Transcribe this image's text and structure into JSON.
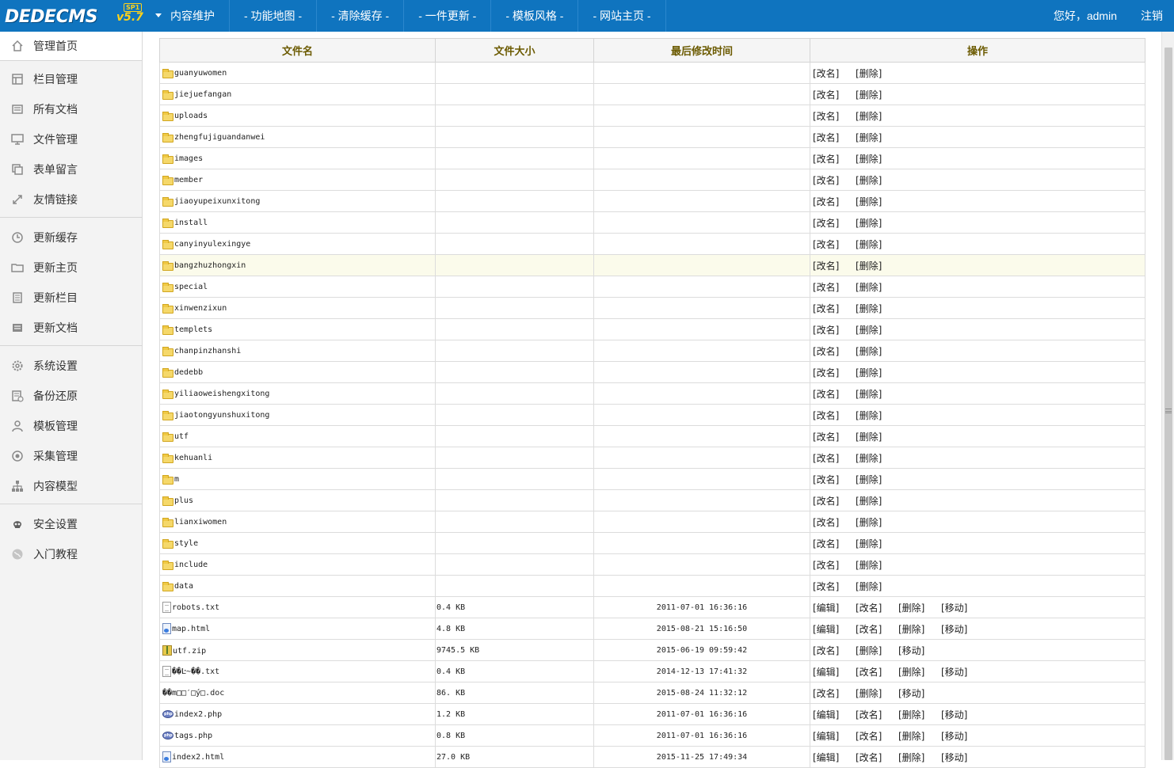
{
  "header": {
    "logo_text": "DEDECMS",
    "logo_version": "v5.7",
    "logo_badge": "SP1",
    "nav": [
      "内容维护",
      "- 功能地图 -",
      "- 清除缓存 -",
      "- 一件更新 -",
      "- 模板风格 -",
      "- 网站主页 -"
    ],
    "user_greeting": "您好，admin",
    "logout": "注销"
  },
  "sidebar": {
    "items": [
      {
        "label": "管理首页",
        "icon": "home-icon"
      },
      {
        "label": "栏目管理",
        "icon": "column-icon"
      },
      {
        "label": "所有文档",
        "icon": "document-icon"
      },
      {
        "label": "文件管理",
        "icon": "monitor-icon"
      },
      {
        "label": "表单留言",
        "icon": "copy-icon"
      },
      {
        "label": "友情链接",
        "icon": "link-icon"
      },
      {
        "label": "更新缓存",
        "icon": "clock-icon"
      },
      {
        "label": "更新主页",
        "icon": "folder-icon"
      },
      {
        "label": "更新栏目",
        "icon": "calendar-icon"
      },
      {
        "label": "更新文档",
        "icon": "list-icon"
      },
      {
        "label": "系统设置",
        "icon": "gear-icon"
      },
      {
        "label": "备份还原",
        "icon": "backup-icon"
      },
      {
        "label": "模板管理",
        "icon": "user-icon"
      },
      {
        "label": "采集管理",
        "icon": "collect-icon"
      },
      {
        "label": "内容模型",
        "icon": "sitemap-icon"
      },
      {
        "label": "安全设置",
        "icon": "skull-icon"
      },
      {
        "label": "入门教程",
        "icon": "globe-icon"
      }
    ]
  },
  "table": {
    "headers": [
      "文件名",
      "文件大小",
      "最后修改时间",
      "操作"
    ],
    "ops": {
      "edit": "[编辑]",
      "rename": "[改名]",
      "delete": "[删除]",
      "move": "[移动]"
    },
    "rows": [
      {
        "name": "guanyuwomen",
        "type": "folder",
        "size": "",
        "time": "",
        "ops": [
          "rename",
          "delete"
        ]
      },
      {
        "name": "jiejuefangan",
        "type": "folder",
        "size": "",
        "time": "",
        "ops": [
          "rename",
          "delete"
        ]
      },
      {
        "name": "uploads",
        "type": "folder",
        "size": "",
        "time": "",
        "ops": [
          "rename",
          "delete"
        ]
      },
      {
        "name": "zhengfujiguandanwei",
        "type": "folder",
        "size": "",
        "time": "",
        "ops": [
          "rename",
          "delete"
        ]
      },
      {
        "name": "images",
        "type": "folder",
        "size": "",
        "time": "",
        "ops": [
          "rename",
          "delete"
        ]
      },
      {
        "name": "member",
        "type": "folder",
        "size": "",
        "time": "",
        "ops": [
          "rename",
          "delete"
        ]
      },
      {
        "name": "jiaoyupeixunxitong",
        "type": "folder",
        "size": "",
        "time": "",
        "ops": [
          "rename",
          "delete"
        ]
      },
      {
        "name": "install",
        "type": "folder",
        "size": "",
        "time": "",
        "ops": [
          "rename",
          "delete"
        ]
      },
      {
        "name": "canyinyulexingye",
        "type": "folder",
        "size": "",
        "time": "",
        "ops": [
          "rename",
          "delete"
        ]
      },
      {
        "name": "bangzhuzhongxin",
        "type": "folder",
        "size": "",
        "time": "",
        "ops": [
          "rename",
          "delete"
        ],
        "highlight": true
      },
      {
        "name": "special",
        "type": "folder",
        "size": "",
        "time": "",
        "ops": [
          "rename",
          "delete"
        ]
      },
      {
        "name": "xinwenzixun",
        "type": "folder",
        "size": "",
        "time": "",
        "ops": [
          "rename",
          "delete"
        ]
      },
      {
        "name": "templets",
        "type": "folder",
        "size": "",
        "time": "",
        "ops": [
          "rename",
          "delete"
        ]
      },
      {
        "name": "chanpinzhanshi",
        "type": "folder",
        "size": "",
        "time": "",
        "ops": [
          "rename",
          "delete"
        ]
      },
      {
        "name": "dedebb",
        "type": "folder",
        "size": "",
        "time": "",
        "ops": [
          "rename",
          "delete"
        ]
      },
      {
        "name": "yiliaoweishengxitong",
        "type": "folder",
        "size": "",
        "time": "",
        "ops": [
          "rename",
          "delete"
        ]
      },
      {
        "name": "jiaotongyunshuxitong",
        "type": "folder",
        "size": "",
        "time": "",
        "ops": [
          "rename",
          "delete"
        ]
      },
      {
        "name": "utf",
        "type": "folder",
        "size": "",
        "time": "",
        "ops": [
          "rename",
          "delete"
        ]
      },
      {
        "name": "kehuanli",
        "type": "folder",
        "size": "",
        "time": "",
        "ops": [
          "rename",
          "delete"
        ]
      },
      {
        "name": "m",
        "type": "folder",
        "size": "",
        "time": "",
        "ops": [
          "rename",
          "delete"
        ]
      },
      {
        "name": "plus",
        "type": "folder",
        "size": "",
        "time": "",
        "ops": [
          "rename",
          "delete"
        ]
      },
      {
        "name": "lianxiwomen",
        "type": "folder",
        "size": "",
        "time": "",
        "ops": [
          "rename",
          "delete"
        ]
      },
      {
        "name": "style",
        "type": "folder",
        "size": "",
        "time": "",
        "ops": [
          "rename",
          "delete"
        ]
      },
      {
        "name": "include",
        "type": "folder",
        "size": "",
        "time": "",
        "ops": [
          "rename",
          "delete"
        ]
      },
      {
        "name": "data",
        "type": "folder",
        "size": "",
        "time": "",
        "ops": [
          "rename",
          "delete"
        ]
      },
      {
        "name": "robots.txt",
        "type": "txt",
        "size": "0.4 KB",
        "time": "2011-07-01 16:36:16",
        "ops": [
          "edit",
          "rename",
          "delete",
          "move"
        ]
      },
      {
        "name": "map.html",
        "type": "html",
        "size": "4.8 KB",
        "time": "2015-08-21 15:16:50",
        "ops": [
          "edit",
          "rename",
          "delete",
          "move"
        ]
      },
      {
        "name": "utf.zip",
        "type": "zip",
        "size": "9745.5 KB",
        "time": "2015-06-19 09:59:42",
        "ops": [
          "rename",
          "delete",
          "move"
        ]
      },
      {
        "name": "��Ŀ~��.txt",
        "type": "txt",
        "size": "0.4 KB",
        "time": "2014-12-13 17:41:32",
        "ops": [
          "edit",
          "rename",
          "delete",
          "move"
        ]
      },
      {
        "name": "��m□□′□ý□.doc",
        "type": "none",
        "size": "86. KB",
        "time": "2015-08-24 11:32:12",
        "ops": [
          "rename",
          "delete",
          "move"
        ]
      },
      {
        "name": "index2.php",
        "type": "php",
        "size": "1.2 KB",
        "time": "2011-07-01 16:36:16",
        "ops": [
          "edit",
          "rename",
          "delete",
          "move"
        ]
      },
      {
        "name": "tags.php",
        "type": "php",
        "size": "0.8 KB",
        "time": "2011-07-01 16:36:16",
        "ops": [
          "edit",
          "rename",
          "delete",
          "move"
        ]
      },
      {
        "name": "index2.html",
        "type": "html",
        "size": "27.0 KB",
        "time": "2015-11-25 17:49:34",
        "ops": [
          "edit",
          "rename",
          "delete",
          "move"
        ]
      }
    ]
  }
}
